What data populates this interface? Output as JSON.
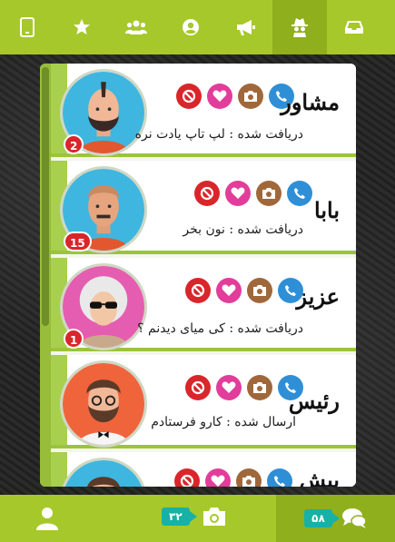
{
  "topnav": {
    "tabs": [
      {
        "name": "phone-icon",
        "active": false
      },
      {
        "name": "star-icon",
        "active": false
      },
      {
        "name": "group-icon",
        "active": false
      },
      {
        "name": "user-circle-icon",
        "active": false
      },
      {
        "name": "megaphone-icon",
        "active": false
      },
      {
        "name": "spy-icon",
        "active": true
      },
      {
        "name": "inbox-icon",
        "active": false
      }
    ]
  },
  "contacts": [
    {
      "name": "مشاور",
      "status": "دریافت شده : لپ تاپ یادت نره",
      "badge": "2"
    },
    {
      "name": "بابا",
      "status": "دریافت شده : نون بخر",
      "badge": "15"
    },
    {
      "name": "عزیز",
      "status": "دریافت شده : کی میای دیدنم ؟",
      "badge": "1"
    },
    {
      "name": "رئیس",
      "status": "ارسال شده : کارو فرستادم",
      "badge": ""
    },
    {
      "name": "پیش",
      "status": "",
      "badge": ""
    }
  ],
  "bottombar": {
    "photos_count": "۳۲",
    "chats_count": "۵۸"
  },
  "colors": {
    "accent": "#a6c82a",
    "accent_dark": "#8faf1c",
    "badge": "#d9262b",
    "heart": "#e23d9a",
    "camera": "#a0683a",
    "phone": "#2f8fd6",
    "count_pill": "#17b1a5"
  }
}
